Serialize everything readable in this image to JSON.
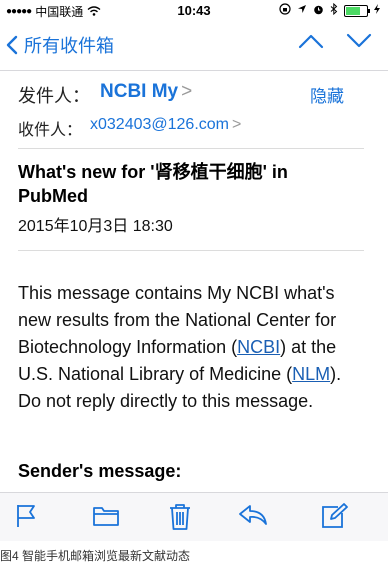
{
  "status_bar": {
    "carrier": "中国联通",
    "time": "10:43"
  },
  "nav": {
    "back_label": "所有收件箱"
  },
  "header": {
    "from_label": "发件人：",
    "from_name": "NCBI My",
    "hide_label": "隐藏",
    "to_label": "收件人：",
    "to_address": "x032403@126.com"
  },
  "message": {
    "subject": "What's new for '肾移植干细胞' in PubMed",
    "date": "2015年10月3日 18:30",
    "body_p1_a": "This message contains My NCBI what's new results from the National Center for Biotechnology Information (",
    "body_link_ncbi": "NCBI",
    "body_p1_b": ") at the U.S. National Library of Medicine (",
    "body_link_nlm": "NLM",
    "body_p1_c": ").",
    "body_p2": "Do not reply directly to this message.",
    "sender_heading": "Sender's message:"
  },
  "toolbar": {
    "icons": [
      "flag-icon",
      "folder-icon",
      "trash-icon",
      "reply-icon",
      "compose-icon"
    ]
  },
  "caption": "图4 智能手机邮箱浏览最新文献动态",
  "colors": {
    "accent": "#1a73d9",
    "battery": "#4cd964"
  }
}
